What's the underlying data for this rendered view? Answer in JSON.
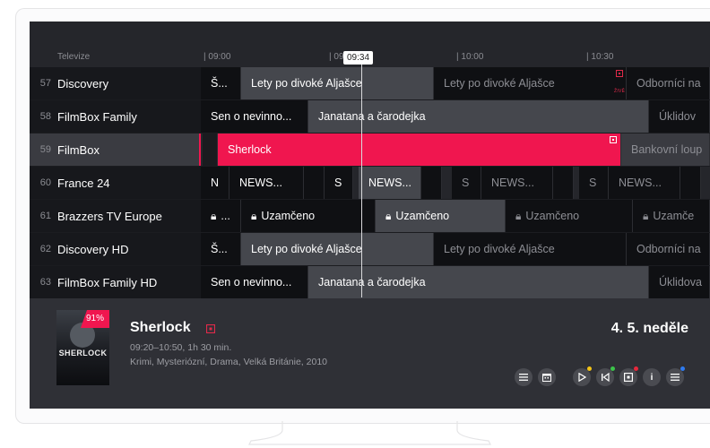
{
  "timeline": {
    "channel_header": "Televize",
    "time_0900": "| 09:00",
    "time_0930": "| 09",
    "time_1000": "| 10:00",
    "time_1030": "| 10:30",
    "now": "09:34"
  },
  "channels": [
    {
      "number": "57",
      "name": "Discovery",
      "programs": [
        "Š...",
        "Lety po divoké Aljašce",
        "Lety po divoké Aljašce",
        "Odborníci na"
      ],
      "live_label": "ŽIVĚ"
    },
    {
      "number": "58",
      "name": "FilmBox Family",
      "programs": [
        "Sen o nevinno...",
        "Janatana a čarodejka",
        "Úklidov"
      ]
    },
    {
      "number": "59",
      "name": "FilmBox",
      "programs": [
        "Sherlock",
        "Bankovní loup"
      ]
    },
    {
      "number": "60",
      "name": "France 24",
      "programs": [
        "N",
        "NEWS...",
        "S",
        "NEWS...",
        "S",
        "NEWS...",
        "S",
        "NEWS..."
      ]
    },
    {
      "number": "61",
      "name": "Brazzers TV Europe",
      "programs": [
        "...",
        "Uzamčeno",
        "Uzamčeno",
        "Uzamčeno",
        "Uzamče"
      ]
    },
    {
      "number": "62",
      "name": "Discovery HD",
      "programs": [
        "Š...",
        "Lety po divoké Aljašce",
        "Lety po divoké Aljašce",
        "Odborníci na"
      ]
    },
    {
      "number": "63",
      "name": "FilmBox Family HD",
      "programs": [
        "Sen o nevinno...",
        "Janatana a čarodejka",
        "Úklidova"
      ]
    }
  ],
  "detail": {
    "rating": "91%",
    "poster_title": "SHERLOCK",
    "title": "Sherlock",
    "time": "09:20–10:50, 1h 30 min.",
    "genres": "Krimi, Mysteriózní, Drama, Velká Británie, 2010",
    "date": "4. 5. neděle"
  },
  "controls": {
    "list_icon": "list-icon",
    "calendar_icon": "calendar-icon",
    "play_icon": "play-icon",
    "restart_icon": "restart-icon",
    "record_icon": "record-icon",
    "info_label": "i",
    "menu_icon": "menu-icon"
  },
  "colors": {
    "accent": "#f0164f",
    "background": "#25262b",
    "yellow_dot": "#f3c316",
    "green_dot": "#3cc44a",
    "red_dot": "#e8283c",
    "blue_dot": "#2f7bf0"
  }
}
